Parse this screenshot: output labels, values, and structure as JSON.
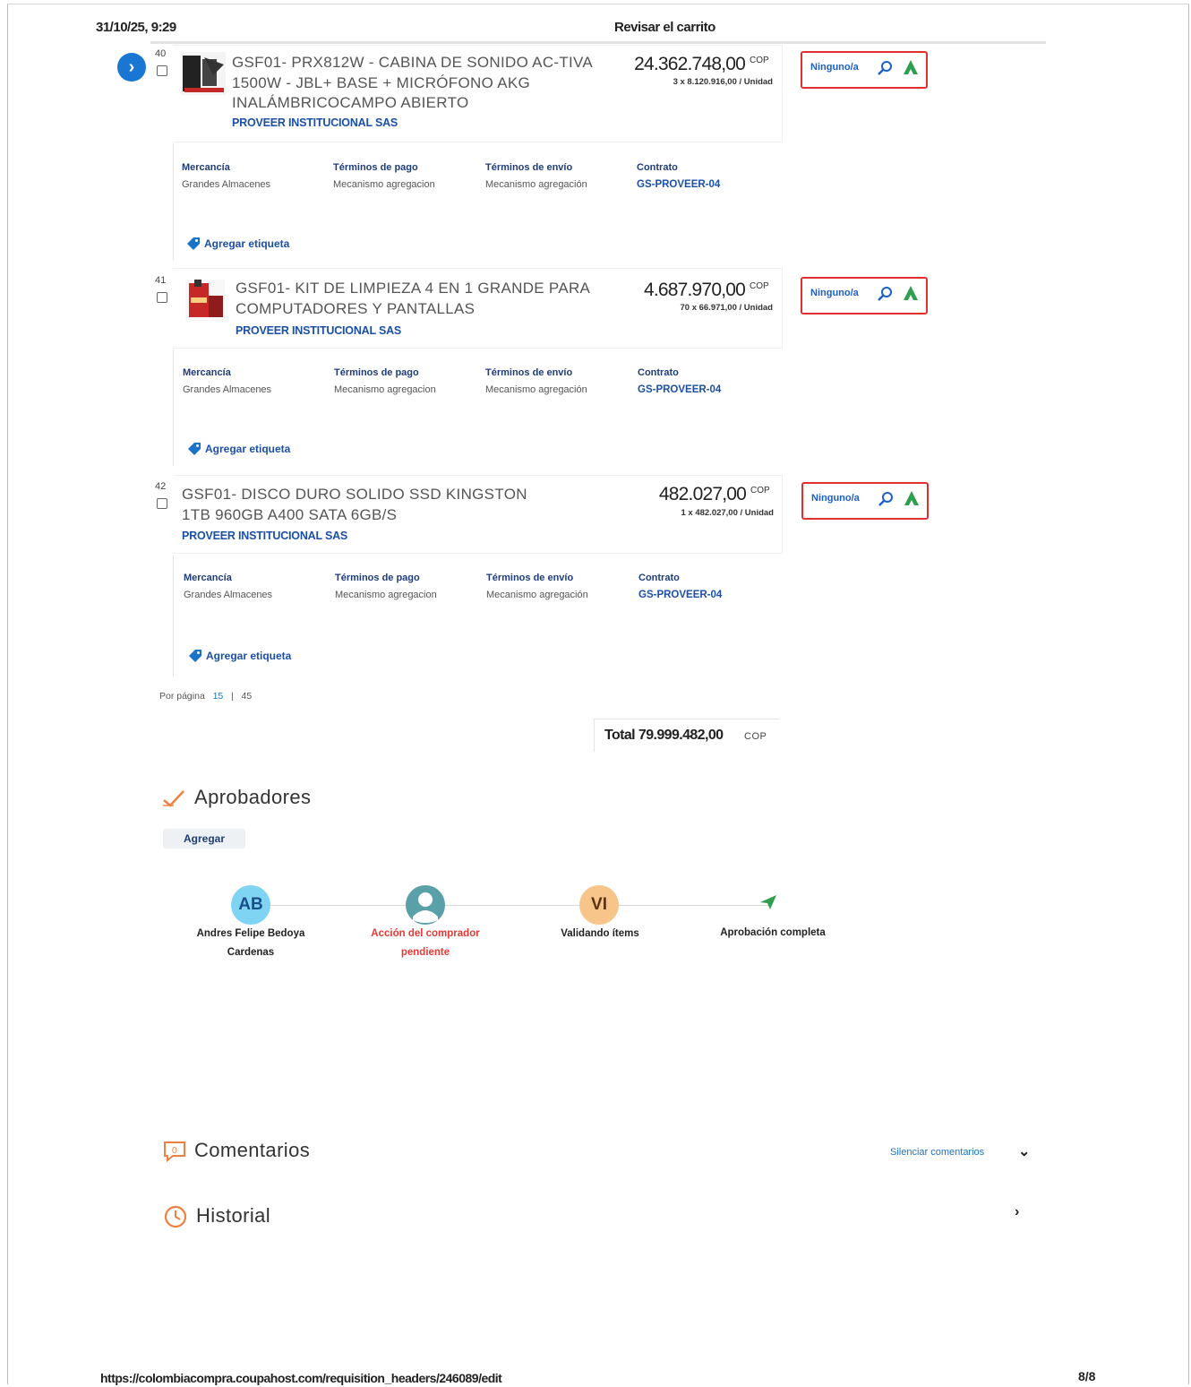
{
  "print": {
    "date": "31/10/25, 9:29",
    "title": "Revisar el carrito",
    "url": "https://colombiacompra.coupahost.com/requisition_headers/246089/edit",
    "page": "8/8"
  },
  "items": [
    {
      "line": "40",
      "name": "GSF01- PRX812W - CABINA DE SONIDO AC-TIVA 1500W - JBL+ BASE + MICRÓFONO AKG INALÁMBRICOCAMPO ABIERTO",
      "supplier": "PROVEER INSTITUCIONAL SAS",
      "price": "24.362.748,00",
      "currency": "COP",
      "unit_calc": "3 x 8.120.916,00 / Unidad",
      "account": "Ninguno/a",
      "fields": [
        {
          "label": "Mercancía",
          "value": "Grandes Almacenes"
        },
        {
          "label": "Términos de pago",
          "value": "Mecanismo agregacion"
        },
        {
          "label": "Términos de envío",
          "value": "Mecanismo agregación"
        },
        {
          "label": "Contrato",
          "value": "GS-PROVEER-04"
        }
      ],
      "add_tag": "Agregar etiqueta"
    },
    {
      "line": "41",
      "name": "GSF01- KIT DE LIMPIEZA 4 EN 1 GRANDE PARA COMPUTADORES Y PANTALLAS",
      "supplier": "PROVEER INSTITUCIONAL SAS",
      "price": "4.687.970,00",
      "currency": "COP",
      "unit_calc": "70 x 66.971,00 / Unidad",
      "account": "Ninguno/a",
      "fields": [
        {
          "label": "Mercancía",
          "value": "Grandes Almacenes"
        },
        {
          "label": "Términos de pago",
          "value": "Mecanismo agregacion"
        },
        {
          "label": "Términos de envío",
          "value": "Mecanismo agregación"
        },
        {
          "label": "Contrato",
          "value": "GS-PROVEER-04"
        }
      ],
      "add_tag": "Agregar etiqueta"
    },
    {
      "line": "42",
      "name": "GSF01- DISCO DURO SOLIDO SSD KINGSTON 1TB 960GB A400 SATA 6GB/S",
      "supplier": "PROVEER INSTITUCIONAL SAS",
      "price": "482.027,00",
      "currency": "COP",
      "unit_calc": "1 x 482.027,00 / Unidad",
      "account": "Ninguno/a",
      "fields": [
        {
          "label": "Mercancía",
          "value": "Grandes Almacenes"
        },
        {
          "label": "Términos de pago",
          "value": "Mecanismo agregacion"
        },
        {
          "label": "Términos de envío",
          "value": "Mecanismo agregación"
        },
        {
          "label": "Contrato",
          "value": "GS-PROVEER-04"
        }
      ],
      "add_tag": "Agregar etiqueta"
    }
  ],
  "pagination": {
    "label": "Por página",
    "option_a": "15",
    "separator": "|",
    "option_b": "45"
  },
  "total": {
    "label": "Total",
    "amount": "79.999.482,00",
    "currency": "COP"
  },
  "approvers": {
    "title": "Aprobadores",
    "add_label": "Agregar",
    "steps": [
      {
        "initials": "AB",
        "name_line1": "Andres Felipe Bedoya",
        "name_line2": "Cardenas",
        "color": "#222222"
      },
      {
        "initials": "",
        "name_line1": "Acción del comprador",
        "name_line2": "pendiente",
        "color": "#e53935"
      },
      {
        "initials": "VI",
        "name_line1": "Validando ítems",
        "name_line2": "",
        "color": "#222222"
      },
      {
        "initials": "",
        "name_line1": "Aprobación completa",
        "name_line2": "",
        "color": "#222222"
      }
    ]
  },
  "comments": {
    "title": "Comentarios",
    "collapse_label": "Silenciar comentarios"
  },
  "history": {
    "title": "Historial"
  },
  "icons": {
    "nav": "chevron-right-icon",
    "account_search": "magnifier-icon",
    "account_tree": "tree-icon",
    "tag": "tag-icon",
    "approvers": "checkmark-icon",
    "comments": "speech-bubble-icon",
    "history": "clock-icon",
    "avatar_placeholder": "user-icon",
    "approval_complete": "paper-plane-icon"
  },
  "colors": {
    "accent": "#1976d2",
    "link": "#1b4fa8",
    "alert": "#e03030",
    "orange": "#f08040"
  }
}
